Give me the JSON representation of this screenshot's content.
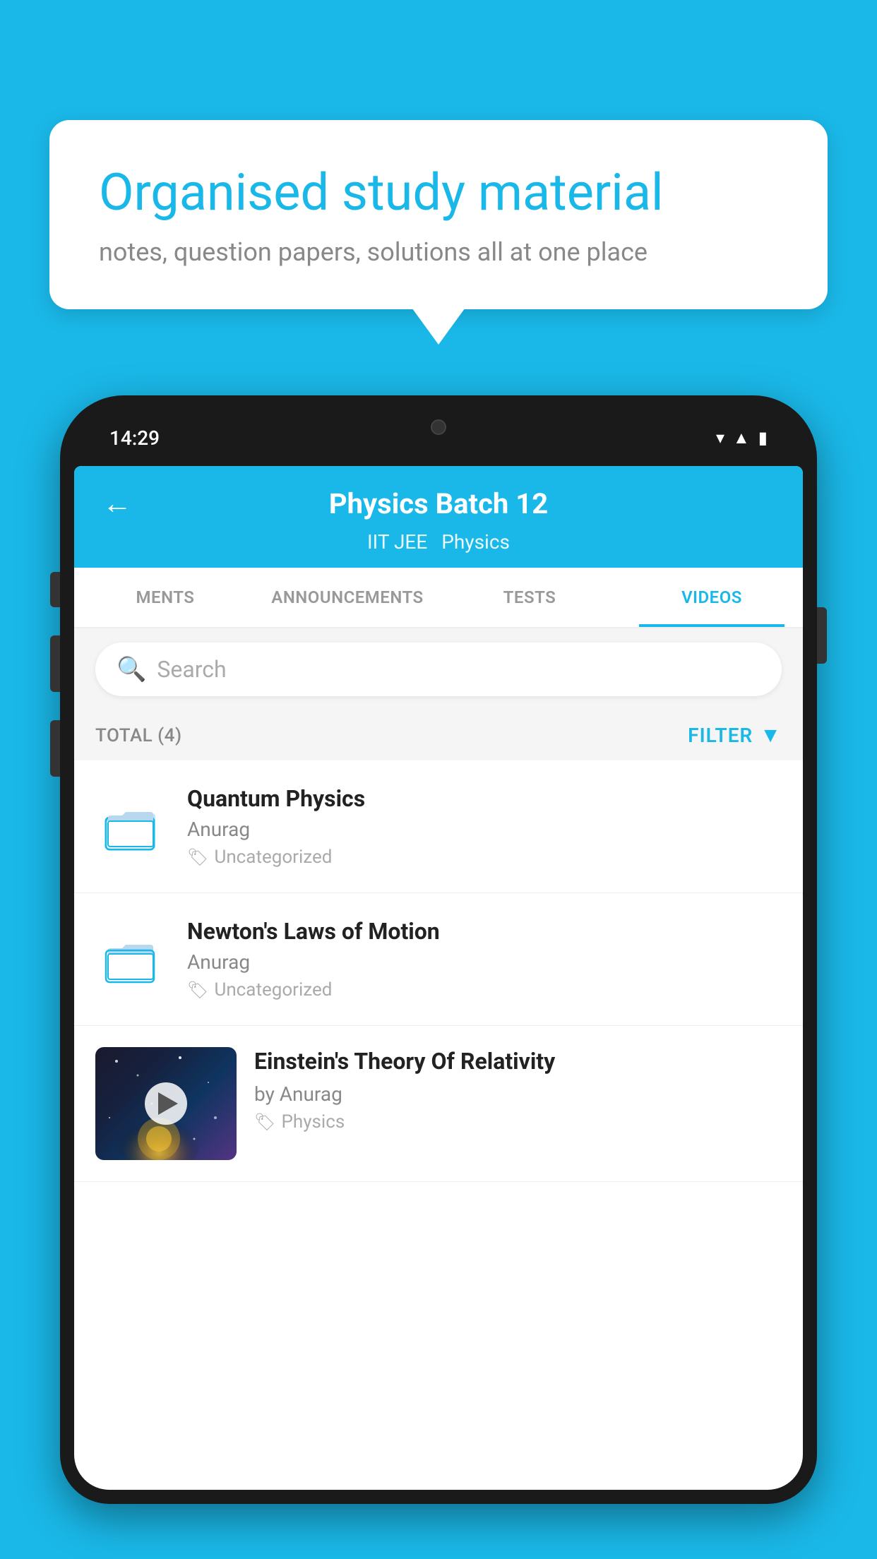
{
  "page": {
    "background_color": "#1ab8e8"
  },
  "bubble": {
    "title": "Organised study material",
    "subtitle": "notes, question papers, solutions all at one place"
  },
  "phone": {
    "status_bar": {
      "time": "14:29"
    },
    "header": {
      "title": "Physics Batch 12",
      "tag1": "IIT JEE",
      "tag2": "Physics",
      "back_label": "←"
    },
    "tabs": [
      {
        "label": "MENTS",
        "active": false
      },
      {
        "label": "ANNOUNCEMENTS",
        "active": false
      },
      {
        "label": "TESTS",
        "active": false
      },
      {
        "label": "VIDEOS",
        "active": true
      }
    ],
    "search": {
      "placeholder": "Search"
    },
    "filter": {
      "total_label": "TOTAL (4)",
      "filter_label": "FILTER"
    },
    "videos": [
      {
        "title": "Quantum Physics",
        "author": "Anurag",
        "tag": "Uncategorized",
        "type": "folder"
      },
      {
        "title": "Newton's Laws of Motion",
        "author": "Anurag",
        "tag": "Uncategorized",
        "type": "folder"
      },
      {
        "title": "Einstein's Theory Of Relativity",
        "author": "by Anurag",
        "tag": "Physics",
        "type": "video"
      }
    ]
  }
}
